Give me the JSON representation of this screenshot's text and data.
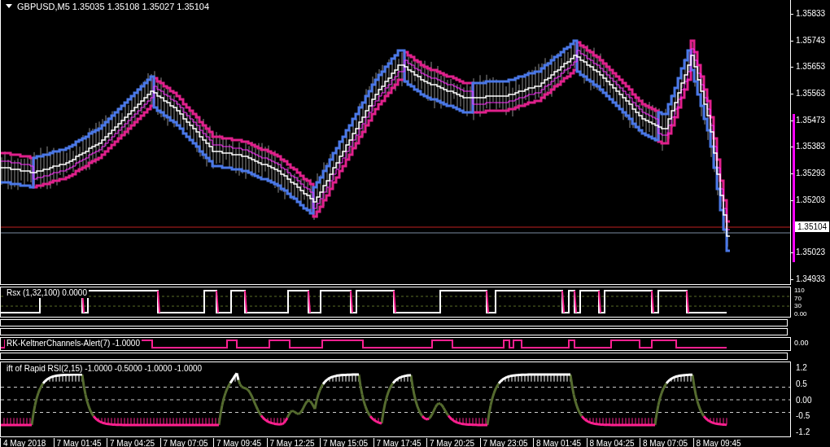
{
  "main_chart": {
    "title": "GBPUSD,M5  1.35035 1.35108 1.35027 1.35104",
    "price_axis": [
      "1.35833",
      "1.35743",
      "1.35653",
      "1.35563",
      "1.35473",
      "1.35383",
      "1.35293",
      "1.35203",
      "1.35023",
      "1.34933"
    ],
    "current_price": "1.35104"
  },
  "indicators": [
    {
      "kind": "rsx",
      "label": "Rsx (1,32,100) 0.0000",
      "axis": [
        "110",
        "70",
        "30",
        "0.00"
      ]
    },
    {
      "kind": "empty"
    },
    {
      "kind": "empty"
    },
    {
      "kind": "keltner",
      "label": "RK-KeltnerChannels-Alert(7) -1.0000",
      "axis": [
        "0.00"
      ]
    },
    {
      "kind": "empty"
    },
    {
      "kind": "ift",
      "label": "ift of Rapid RSI(2,15) -1.0000 -0.5000 -1.0000 -1.0000",
      "axis": [
        "1.2",
        "0.5",
        "0.00",
        "-0.5",
        "-1.2"
      ]
    }
  ],
  "time_axis": [
    "4 May 2018",
    "7 May 01:45",
    "7 May 04:25",
    "7 May 07:05",
    "7 May 09:45",
    "7 May 12:25",
    "7 May 15:05",
    "7 May 17:45",
    "7 May 20:25",
    "7 May 23:05",
    "8 May 01:45",
    "8 May 04:25",
    "8 May 07:05",
    "8 May 09:45"
  ]
}
